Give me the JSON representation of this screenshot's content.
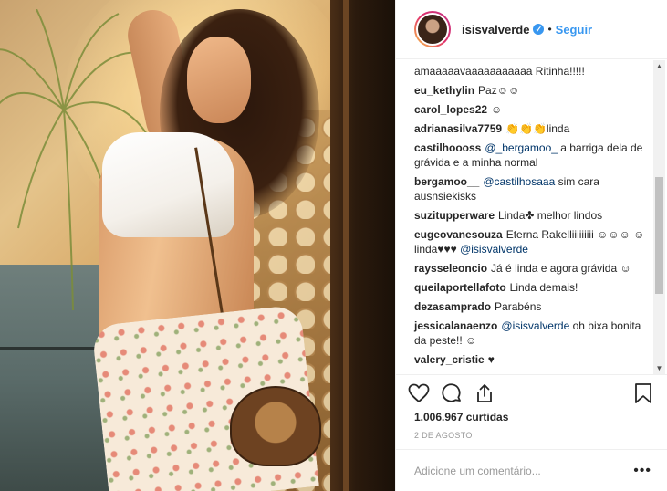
{
  "header": {
    "username": "isisvalverde",
    "separator": "•",
    "follow_label": "Seguir",
    "verified_icon": "verified-badge-icon"
  },
  "comments": [
    {
      "user": "",
      "text": "amaaaaavaaaaaaaaaaa Ritinha!!!!!"
    },
    {
      "user": "eu_kethylin",
      "text": "Paz☺☺"
    },
    {
      "user": "carol_lopes22",
      "text": "☺"
    },
    {
      "user": "adrianasilva7759",
      "text": "👏👏👏linda"
    },
    {
      "user": "castilhoooss",
      "mention": "@_bergamoo_",
      "text": " a barriga dela de grávida e a minha normal"
    },
    {
      "user": "bergamoo__",
      "mention": "@castilhosaaa",
      "text": " sim cara ausnsiekisks"
    },
    {
      "user": "suzitupperware",
      "text": "Linda✤ melhor lindos"
    },
    {
      "user": "eugeovanesouza",
      "text": "Eterna Rakelliiiiiiiii ☺☺☺ ☺ linda♥♥♥ ",
      "mention_after": "@isisvalverde"
    },
    {
      "user": "raysseleoncio",
      "text": "Já é linda e agora grávida ☺"
    },
    {
      "user": "queilaportellafoto",
      "text": "Linda demais!"
    },
    {
      "user": "dezasamprado",
      "text": "Parabéns"
    },
    {
      "user": "jessicalanaenzo",
      "mention": "@isisvalverde",
      "text": " oh bixa bonita da peste!! ☺"
    },
    {
      "user": "valery_cristie",
      "text": "♥"
    }
  ],
  "actions": {
    "like_icon": "heart-icon",
    "comment_icon": "comment-bubble-icon",
    "share_icon": "share-icon",
    "save_icon": "bookmark-icon"
  },
  "likes_text": "1.006.967 curtidas",
  "date_text": "2 DE AGOSTO",
  "comment_box": {
    "placeholder": "Adicione um comentário...",
    "more_label": "•••"
  },
  "colors": {
    "link_blue": "#3897f0",
    "mention_blue": "#003569",
    "muted_gray": "#999999",
    "border": "#efefef"
  }
}
